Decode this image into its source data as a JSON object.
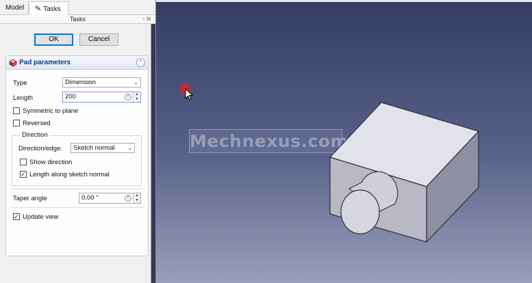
{
  "tabs": {
    "model": "Model",
    "tasks": "Tasks"
  },
  "tasks_header": "Tasks",
  "buttons": {
    "ok": "OK",
    "cancel": "Cancel"
  },
  "pad": {
    "title": "Pad parameters",
    "type_label": "Type",
    "type_value": "Dimension",
    "length_label": "Length",
    "length_value": "200",
    "symmetric_label": "Symmetric to plane",
    "symmetric_checked": false,
    "reversed_label": "Reversed",
    "reversed_checked": false,
    "direction_group": "Direction",
    "direction_edge_label": "Direction/edge:",
    "direction_edge_value": "Sketch normal",
    "show_direction_label": "Show direction",
    "show_direction_checked": false,
    "length_along_label": "Length along sketch normal",
    "length_along_checked": true,
    "taper_label": "Taper angle",
    "taper_value": "0.00 °",
    "update_view_label": "Update view",
    "update_view_checked": true
  },
  "viewport": {
    "watermark": "Mechnexus.com"
  },
  "colors": {
    "panel_bg": "#f0f0f0",
    "title_blue": "#0b3f8c",
    "ok_border": "#0078d7",
    "viewport_top": "#343b65",
    "viewport_bottom": "#9aa0bb",
    "cursor_highlight": "#d62626",
    "model_face_front": "#b9b9c6",
    "model_face_top": "#e2e2ea",
    "model_face_side": "#8e8fa3"
  }
}
